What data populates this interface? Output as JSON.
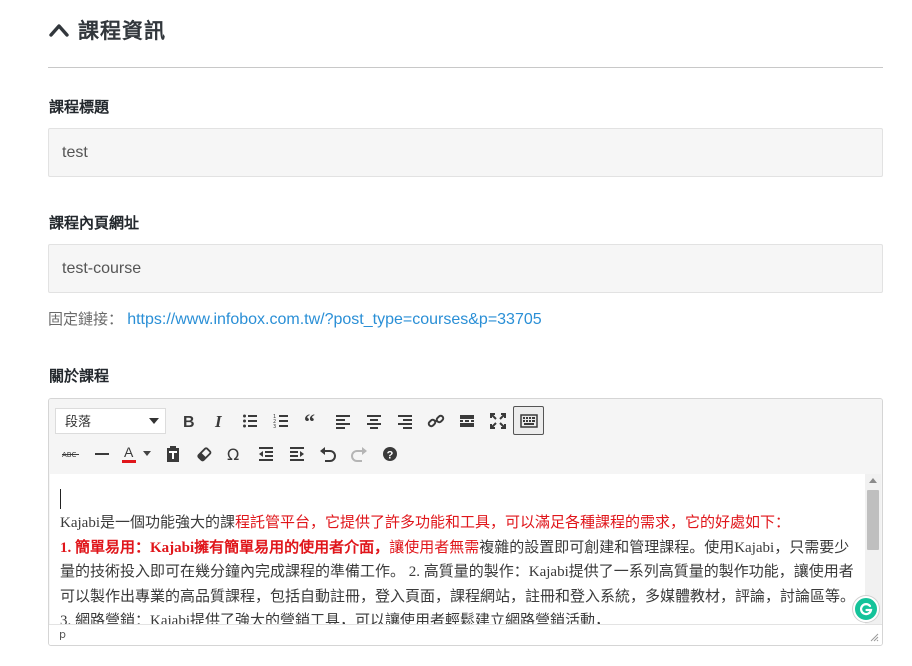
{
  "section": {
    "title": "課程資訊",
    "icon": "chevron-up-icon"
  },
  "course_title": {
    "label": "課程標題",
    "value": "test"
  },
  "course_slug": {
    "label": "課程內頁網址",
    "value": "test-course"
  },
  "permalink": {
    "label": "固定鏈接：",
    "url": "https://www.infobox.com.tw/?post_type=courses&p=33705"
  },
  "about": {
    "label": "關於課程"
  },
  "editor": {
    "format_select": "段落",
    "toolbar_row1": [
      "bold-icon",
      "italic-icon",
      "bullet-list-icon",
      "numbered-list-icon",
      "blockquote-icon",
      "align-left-icon",
      "align-center-icon",
      "align-right-icon",
      "link-icon",
      "read-more-icon",
      "fullscreen-icon",
      "toolbar-toggle-icon"
    ],
    "toolbar_row2": [
      "strikethrough-icon",
      "horizontal-line-icon",
      "text-color-icon",
      "paste-as-text-icon",
      "clear-formatting-icon",
      "special-character-icon",
      "outdent-icon",
      "indent-icon",
      "undo-icon",
      "redo-icon",
      "help-icon"
    ],
    "text_color": "#e0161b",
    "content": {
      "line1_normal": "Kajabi是一個功能強大的課",
      "line1_red": "程託管平台，它提供了許多功能和工具，可以滿足各種課程的需求，它的好處如下：",
      "line2_bold_red": "1. 簡單易用：Kajabi擁有簡單易用的使用者介面，",
      "line2_red": "讓使用者無需",
      "line2_normal": "複雜的設置即可創建和管理課程。使用Kajabi，只需要少量的技術投入即可在幾分鐘內完成課程的準備工作。 2. 高質量的製作：Kajabi提供了一系列高質量的製作功能，讓使用者可以製作出專業的高品質課程，包括自動註冊，登入頁面，課程網站，註冊和登入系統，多媒體教材，評論，討論區等。 3. 網路營銷：Kajabi提供了強大的營銷工具，可以讓使用者輕鬆建立網路營銷活動，"
    },
    "status_path": "p"
  }
}
